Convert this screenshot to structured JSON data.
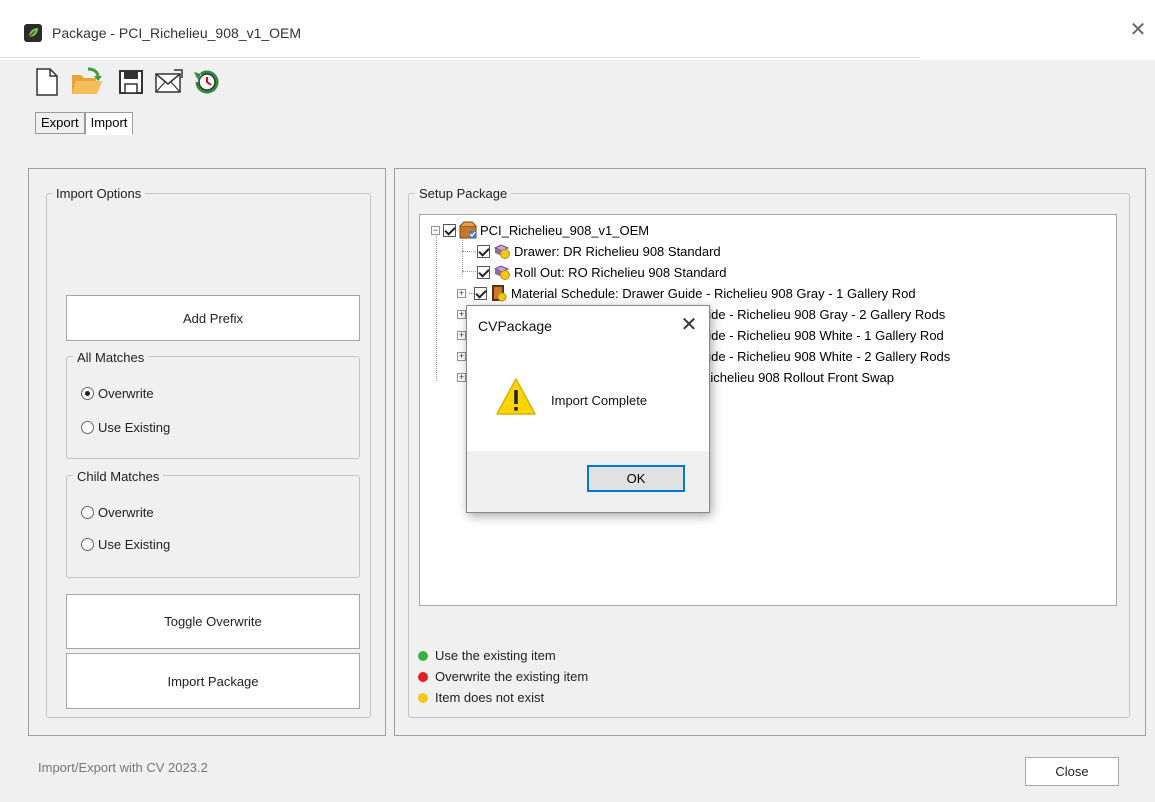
{
  "window": {
    "title": "Package - PCI_Richelieu_908_v1_OEM",
    "close_glyph": "✕"
  },
  "toolbar": {
    "icons": [
      "new-file-icon",
      "open-folder-icon",
      "save-icon",
      "email-icon",
      "history-clock-icon"
    ]
  },
  "tabs": [
    {
      "label": "Export",
      "active": false
    },
    {
      "label": "Import",
      "active": true
    }
  ],
  "import_options": {
    "group_label": "Import Options",
    "add_prefix_label": "Add Prefix",
    "all_matches": {
      "label": "All Matches",
      "options": [
        {
          "label": "Overwrite",
          "checked": true
        },
        {
          "label": "Use Existing",
          "checked": false
        }
      ]
    },
    "child_matches": {
      "label": "Child Matches",
      "options": [
        {
          "label": "Overwrite",
          "checked": false
        },
        {
          "label": "Use Existing",
          "checked": false
        }
      ]
    },
    "toggle_overwrite_label": "Toggle Overwrite",
    "import_package_label": "Import Package"
  },
  "setup_package": {
    "group_label": "Setup Package",
    "tree": [
      {
        "label": "PCI_Richelieu_908_v1_OEM",
        "level": 0,
        "expander": "−",
        "checked": true,
        "icon": "package-icon"
      },
      {
        "label": "Drawer: DR Richelieu 908 Standard",
        "level": 1,
        "expander": null,
        "checked": true,
        "icon": "drawer-icon"
      },
      {
        "label": "Roll Out: RO Richelieu 908 Standard",
        "level": 1,
        "expander": null,
        "checked": true,
        "icon": "rollout-icon"
      },
      {
        "label": "Material Schedule: Drawer Guide - Richelieu 908 Gray - 1 Gallery Rod",
        "level": 1,
        "expander": "+",
        "checked": true,
        "icon": "material-schedule-icon"
      },
      {
        "label": "uide - Richelieu 908 Gray - 2 Gallery Rods",
        "level": 1,
        "expander": "+",
        "checked": true,
        "icon": "material-schedule-icon"
      },
      {
        "label": "uide - Richelieu 908 White - 1 Gallery Rod",
        "level": 1,
        "expander": "+",
        "checked": true,
        "icon": "material-schedule-icon"
      },
      {
        "label": "uide - Richelieu 908 White - 2 Gallery Rods",
        "level": 1,
        "expander": "+",
        "checked": true,
        "icon": "material-schedule-icon"
      },
      {
        "label": "Richelieu 908 Rollout Front Swap",
        "level": 1,
        "expander": "+",
        "checked": true,
        "icon": "material-schedule-icon"
      }
    ],
    "legend": [
      {
        "label": "Use the existing item",
        "color": "#3cb043"
      },
      {
        "label": "Overwrite the existing item",
        "color": "#e02020"
      },
      {
        "label": "Item does not exist",
        "color": "#f5c518"
      }
    ]
  },
  "footer": {
    "status_text": "Import/Export with CV 2023.2",
    "close_label": "Close"
  },
  "dialog": {
    "title": "CVPackage",
    "close_glyph": "✕",
    "message": "Import Complete",
    "ok_label": "OK",
    "icon": "warning-icon"
  }
}
